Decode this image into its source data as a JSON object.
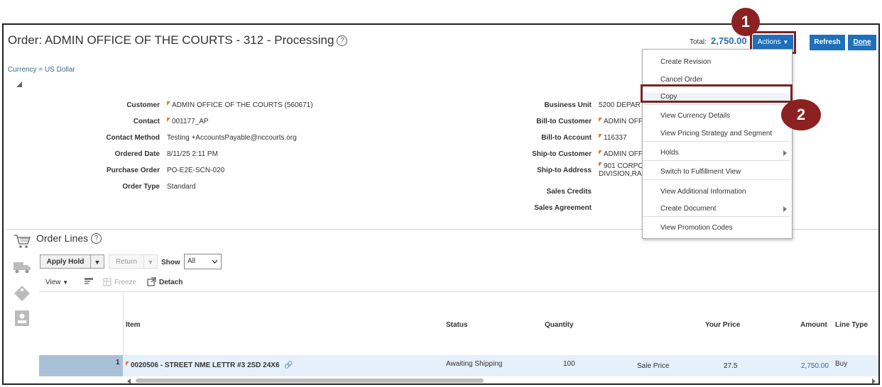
{
  "header": {
    "title": "Order: ADMIN OFFICE OF THE COURTS - 312 - Processing",
    "help": "?",
    "currency": "Currency = US Dollar",
    "total_label": "Total:",
    "total_value": "2,750.00",
    "actions_label": "Actions",
    "refresh_label": "Refresh",
    "done_label": "Done"
  },
  "callouts": {
    "one": "1",
    "two": "2"
  },
  "details_left": [
    {
      "label": "Customer",
      "value": "ADMIN OFFICE OF THE COURTS (560671)",
      "flag": true
    },
    {
      "label": "Contact",
      "value": "001177_AP",
      "flag": true
    },
    {
      "label": "Contact Method",
      "value": "Testing +AccountsPayable@nccourts.org",
      "flag": false
    },
    {
      "label": "Ordered Date",
      "value": "8/11/25 2:11 PM",
      "flag": false
    },
    {
      "label": "Purchase Order",
      "value": "PO-E2E-SCN-020",
      "flag": false
    },
    {
      "label": "Order Type",
      "value": "Standard",
      "flag": false
    }
  ],
  "details_right": {
    "business_unit_label": "Business Unit",
    "business_unit_value": "5200 DEPAR",
    "bill_to_customer_label": "Bill-to Customer",
    "bill_to_customer_value": "ADMIN OFFI",
    "bill_to_account_label": "Bill-to Account",
    "bill_to_account_value": "116337",
    "ship_to_customer_label": "Ship-to Customer",
    "ship_to_customer_value": "ADMIN OFFI",
    "ship_to_address_label": "Ship-to Address",
    "ship_to_address_line1": "901 CORPO",
    "ship_to_address_line2": "DIVISION,RAI",
    "sales_credits_label": "Sales Credits",
    "sales_agreement_label": "Sales Agreement"
  },
  "actions_menu": {
    "create_revision": "Create Revision",
    "cancel_order": "Cancel Order",
    "copy": "Copy",
    "view_currency_details": "View Currency Details",
    "view_pricing_strategy": "View Pricing Strategy and Segment",
    "holds": "Holds",
    "switch_to_fulfillment": "Switch to Fulfillment View",
    "view_additional_info": "View Additional Information",
    "create_document": "Create Document",
    "view_promotion_codes": "View Promotion Codes"
  },
  "order_lines": {
    "title": "Order Lines",
    "apply_hold": "Apply Hold",
    "return": "Return",
    "show_label": "Show",
    "show_value": "All",
    "view_label": "View",
    "freeze_label": "Freeze",
    "detach_label": "Detach",
    "columns": {
      "item": "Item",
      "status": "Status",
      "quantity": "Quantity",
      "your_price": "Your Price",
      "amount": "Amount",
      "line_type": "Line Type"
    },
    "rows": [
      {
        "num": "1",
        "item": "0020506 - STREET NME LETTR #3 2SD 24X6",
        "status": "Awaiting Shipping",
        "quantity": "100",
        "price_type": "Sale Price",
        "your_price": "27.5",
        "amount": "2,750.00",
        "line_type": "Buy"
      }
    ]
  }
}
